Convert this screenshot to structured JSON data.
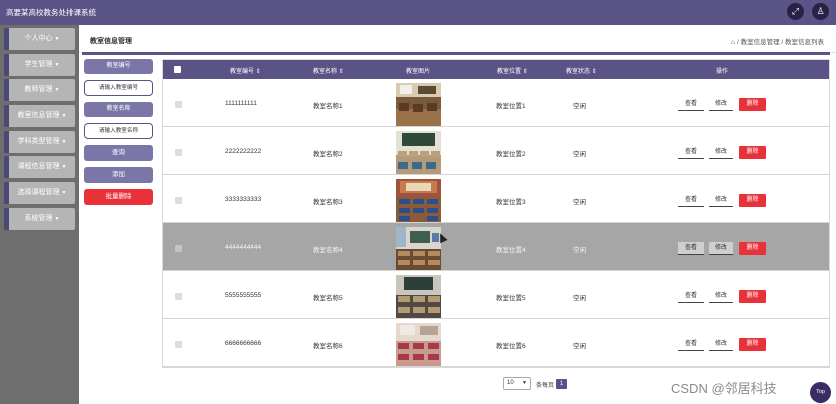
{
  "app": {
    "title": "高要某高校教务处排课系统"
  },
  "topbar_icons": [
    "fullscreen-icon",
    "user-icon"
  ],
  "sidebar": {
    "items": [
      {
        "label": "个人中心"
      },
      {
        "label": "学生管理"
      },
      {
        "label": "教师管理"
      },
      {
        "label": "教室信息管理"
      },
      {
        "label": "学科类型管理"
      },
      {
        "label": "课程信息管理"
      },
      {
        "label": "选择课程管理"
      },
      {
        "label": "系统管理"
      }
    ]
  },
  "header": {
    "page_title": "教室信息管理",
    "breadcrumb": "/ 教室信息管理 / 教室信息列表"
  },
  "filters": {
    "field1_label": "教室编号",
    "field1_placeholder": "请输入教室编号",
    "field2_label": "教室名称",
    "field2_placeholder": "请输入教室名称",
    "search_label": "查询",
    "add_label": "添加",
    "batch_delete_label": "批量删除"
  },
  "table": {
    "headers": {
      "number": "教室编号 ⇕",
      "name": "教室名称 ⇕",
      "picture": "教室图片",
      "location": "教室位置 ⇕",
      "status": "教室状态 ⇕",
      "actions": "操作"
    },
    "rows": [
      {
        "number": "1111111111",
        "name": "教室名称1",
        "location": "教室位置1",
        "status": "空闲"
      },
      {
        "number": "2222222222",
        "name": "教室名称2",
        "location": "教室位置2",
        "status": "空闲"
      },
      {
        "number": "3333333333",
        "name": "教室名称3",
        "location": "教室位置3",
        "status": "空闲"
      },
      {
        "number": "4444444444",
        "name": "教室名称4",
        "location": "教室位置4",
        "status": "空闲"
      },
      {
        "number": "5555555555",
        "name": "教室名称5",
        "location": "教室位置5",
        "status": "空闲"
      },
      {
        "number": "6666666666",
        "name": "教室名称6",
        "location": "教室位置6",
        "status": "空闲"
      }
    ],
    "actions": {
      "view": "查看",
      "edit": "修改",
      "delete": "删除"
    }
  },
  "pagination": {
    "page_size": "10",
    "per_page_label": "条每页",
    "current_page": "1"
  },
  "watermark": "CSDN @邻居科技",
  "top_button": "Top",
  "colors": {
    "primary": "#5a5386",
    "accent_button": "#7b76a8",
    "danger": "#e8323a",
    "sidebar_bg": "#6e6e6e",
    "highlight_row": "#a6a6a6"
  }
}
